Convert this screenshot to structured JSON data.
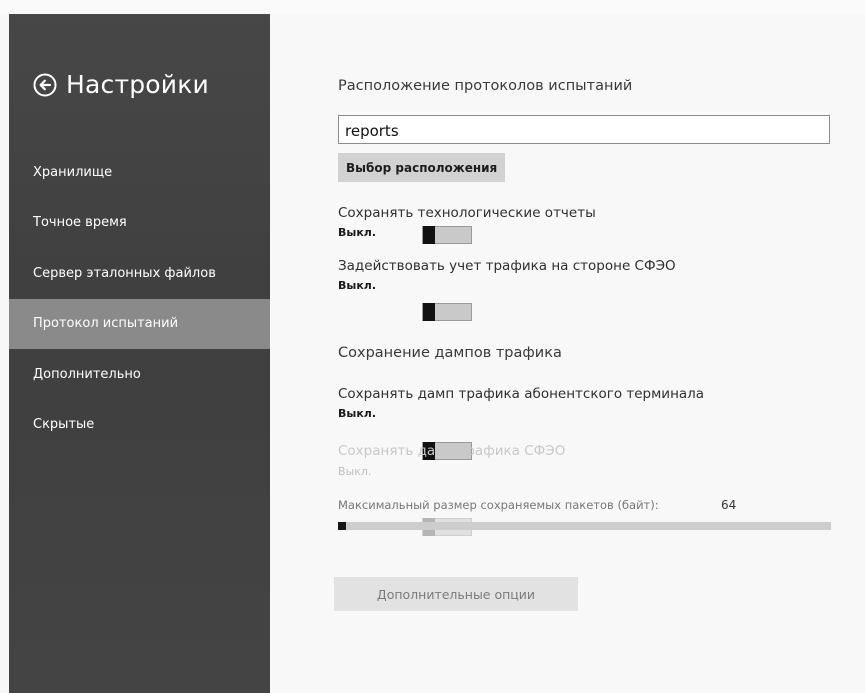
{
  "sidebar": {
    "title": "Настройки",
    "items": [
      {
        "label": "Хранилище",
        "active": false
      },
      {
        "label": "Точное время",
        "active": false
      },
      {
        "label": "Сервер эталонных файлов",
        "active": false
      },
      {
        "label": "Протокол испытаний",
        "active": true
      },
      {
        "label": "Дополнительно",
        "active": false
      },
      {
        "label": "Скрытые",
        "active": false
      }
    ]
  },
  "main": {
    "reports_section": {
      "heading": "Расположение протоколов испытаний",
      "path_value": "reports",
      "choose_button": "Выбор расположения"
    },
    "settings": [
      {
        "label": "Сохранять технологические отчеты",
        "state": "Выкл.",
        "enabled": true
      },
      {
        "label": "Задействовать учет трафика на стороне СФЭО",
        "state": "Выкл.",
        "enabled": true
      }
    ],
    "dumps_section": {
      "heading": "Сохранение дампов трафика",
      "settings": [
        {
          "label": "Сохранять дамп трафика абонентского терминала",
          "state": "Выкл.",
          "enabled": true
        },
        {
          "label": "Сохранять дамп трафика СФЭО",
          "state": "Выкл.",
          "enabled": false
        }
      ],
      "packet_size": {
        "label": "Максимальный размер сохраняемых пакетов (байт):",
        "value": "64",
        "fill_fraction": 0.016
      }
    },
    "more_options_button": "Дополнительные опции"
  },
  "colors": {
    "sidebar_bg": "#444444",
    "sidebar_active": "#8a8a8a",
    "content_bg": "#f8f8f8",
    "button_bg": "#d2d2d2",
    "toggle_thumb": "#111111"
  },
  "icons": {
    "back": "back-arrow-circle-icon"
  }
}
